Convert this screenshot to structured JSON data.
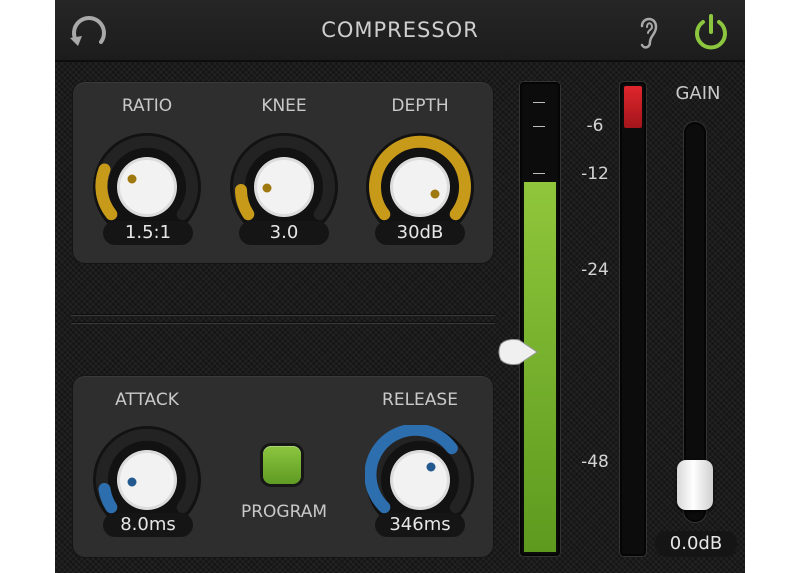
{
  "header": {
    "title": "COMPRESSOR",
    "reset_icon": "undo-arrow-icon",
    "listen_icon": "ear-icon",
    "power_icon": "power-icon",
    "power_color": "#8cc63f"
  },
  "dynamics": {
    "ratio": {
      "label": "RATIO",
      "value": "1.5:1",
      "level": 0.1
    },
    "knee": {
      "label": "KNEE",
      "value": "3.0",
      "level": 0.1
    },
    "depth": {
      "label": "DEPTH",
      "value": "30dB",
      "level": 1.0
    }
  },
  "timing": {
    "attack": {
      "label": "ATTACK",
      "value": "8.0ms",
      "level": 0.05
    },
    "release": {
      "label": "RELEASE",
      "value": "346ms",
      "level": 0.7
    },
    "program": {
      "label": "PROGRAM",
      "active": true
    }
  },
  "meter": {
    "scale": [
      "-6",
      "-12",
      "-24",
      "-48"
    ],
    "input_level_fraction": 0.79,
    "gain_reduction_fraction": 0.1,
    "accent_color": "#8cc63f",
    "clip_color": "#d9232a"
  },
  "gain": {
    "label": "GAIN",
    "value": "0.0dB"
  },
  "colors": {
    "knob_gold": "#c89a1a",
    "knob_blue": "#2d6fae"
  }
}
